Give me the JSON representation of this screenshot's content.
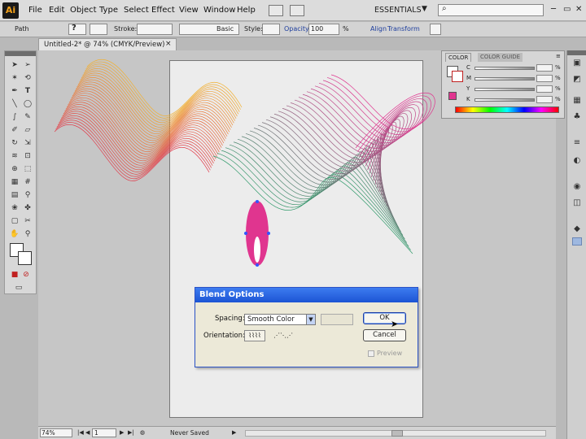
{
  "app": {
    "logo": "Ai",
    "workspace": "ESSENTIALS"
  },
  "menu": [
    "File",
    "Edit",
    "Object",
    "Type",
    "Select",
    "Effect",
    "View",
    "Window",
    "Help"
  ],
  "control_bar": {
    "selection": "Path",
    "stroke_label": "Stroke:",
    "brush": "Basic",
    "style_label": "Style:",
    "opacity_label": "Opacity:",
    "opacity_value": "100",
    "opacity_unit": "%",
    "align": "Align",
    "transform": "Transform"
  },
  "document": {
    "tab_title": "Untitled-2* @ 74% (CMYK/Preview)",
    "close": "×"
  },
  "status": {
    "zoom": "74%",
    "page": "1",
    "save_state": "Never Saved"
  },
  "color_panel": {
    "tabs": [
      "COLOR",
      "COLOR GUIDE"
    ],
    "channels": [
      "C",
      "M",
      "Y",
      "K"
    ],
    "unit": "%"
  },
  "dialog": {
    "title": "Blend Options",
    "spacing_label": "Spacing:",
    "spacing_value": "Smooth Color",
    "orientation_label": "Orientation:",
    "ok": "OK",
    "cancel": "Cancel",
    "preview": "Preview"
  },
  "colors": {
    "accent_pink": "#e0358f",
    "orange": "#f0a030",
    "green": "#3a9a6a",
    "title_blue": "#1c54d4"
  }
}
